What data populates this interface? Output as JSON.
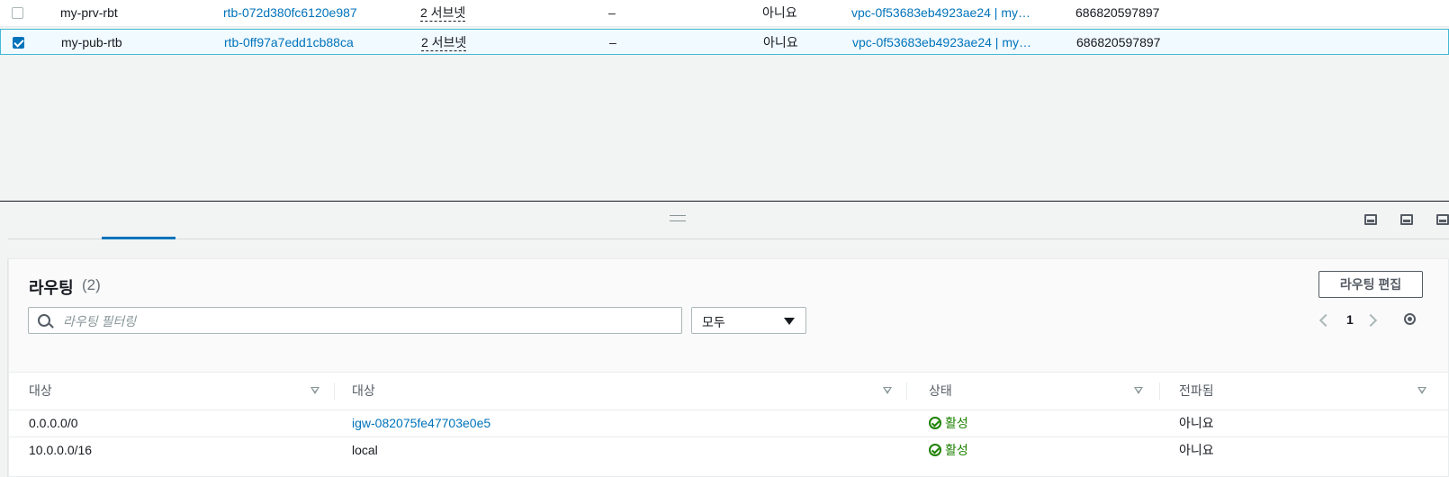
{
  "top_table": {
    "rows": [
      {
        "name": "my-prv-rbt",
        "route_table_id": "rtb-072d380fc6120e987",
        "subnets": "2 서브넷",
        "edge": "–",
        "main": "아니요",
        "vpc": "vpc-0f53683eb4923ae24 | my…",
        "owner": "686820597897",
        "selected": false
      },
      {
        "name": "my-pub-rtb",
        "route_table_id": "rtb-0ff97a7edd1cb88ca",
        "subnets": "2 서브넷",
        "edge": "–",
        "main": "아니요",
        "vpc": "vpc-0f53683eb4923ae24 | my…",
        "owner": "686820597897",
        "selected": true
      }
    ]
  },
  "routes_panel": {
    "title": "라우팅",
    "count": "(2)",
    "edit_button": "라우팅 편집",
    "filter_placeholder": "라우팅 필터링",
    "select_value": "모두",
    "page_number": "1",
    "columns": [
      "대상",
      "대상",
      "상태",
      "전파됨"
    ],
    "rows": [
      {
        "destination": "0.0.0.0/0",
        "target": "igw-082075fe47703e0e5",
        "status": "활성",
        "propagated": "아니요"
      },
      {
        "destination": "10.0.0.0/16",
        "target": "local",
        "status": "활성",
        "propagated": "아니요"
      }
    ]
  },
  "colors": {
    "link": "#0073bb",
    "active_status": "#1d8102",
    "selection_border": "#44b9d6"
  }
}
